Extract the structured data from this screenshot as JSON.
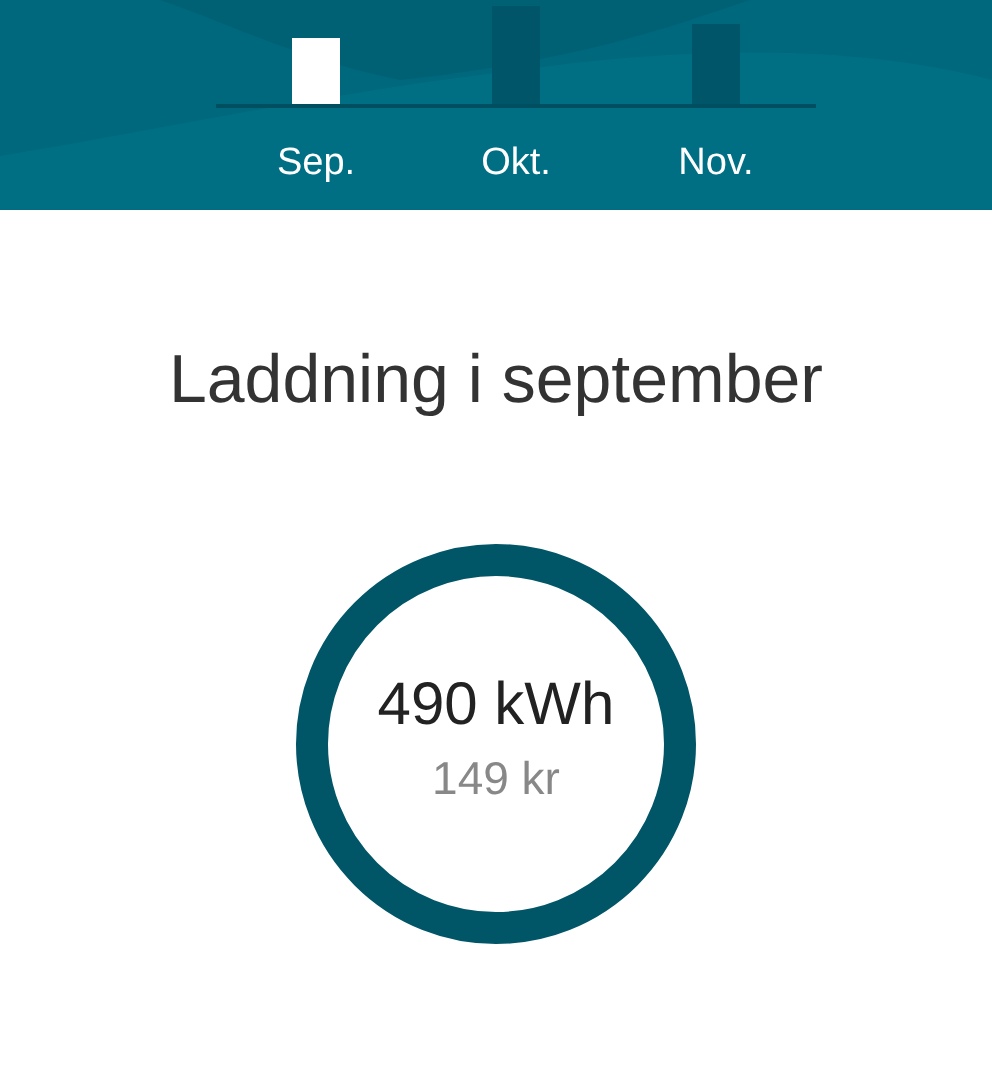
{
  "months": [
    {
      "label": "Sep.",
      "selected": true
    },
    {
      "label": "Okt.",
      "selected": false
    },
    {
      "label": "Nov.",
      "selected": false
    }
  ],
  "title": "Laddning i september",
  "summary": {
    "energy": "490 kWh",
    "cost": "149 kr"
  }
}
